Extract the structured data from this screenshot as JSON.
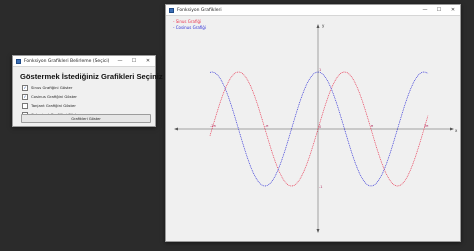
{
  "selection_window": {
    "title": "Fonksiyon Grafikleri Belirleme (Seçici)",
    "heading": "Göstermek İstediğiniz Grafikleri Seçiniz",
    "options": [
      {
        "label": "Sinus Grafiğini Göster",
        "checked": true
      },
      {
        "label": "Cosinus Grafiğini Göster",
        "checked": true
      },
      {
        "label": "Tanjant Grafiğini Göster",
        "checked": false
      },
      {
        "label": "Cotanjant Grafiğini Göster",
        "checked": false
      }
    ],
    "show_button": "Grafikleri Göster"
  },
  "graph_window": {
    "title": "Fonksiyon Grafikleri",
    "legend": [
      {
        "label": "- Sinus Grafiği",
        "color": "#e8334f"
      },
      {
        "label": "- Cosinus Grafiği",
        "color": "#2b2bd6"
      }
    ],
    "axis_labels": {
      "x": "x",
      "y": "y"
    },
    "x_ticks": [
      "-2π",
      "-π",
      "π",
      "2π"
    ],
    "y_ticks": [
      "1",
      "-1"
    ],
    "origin_label": "0"
  },
  "window_controls": {
    "minimize": "—",
    "maximize": "☐",
    "close": "✕"
  },
  "colors": {
    "sine": "#e8334f",
    "cosine": "#2b2bd6",
    "axis": "#555555"
  }
}
